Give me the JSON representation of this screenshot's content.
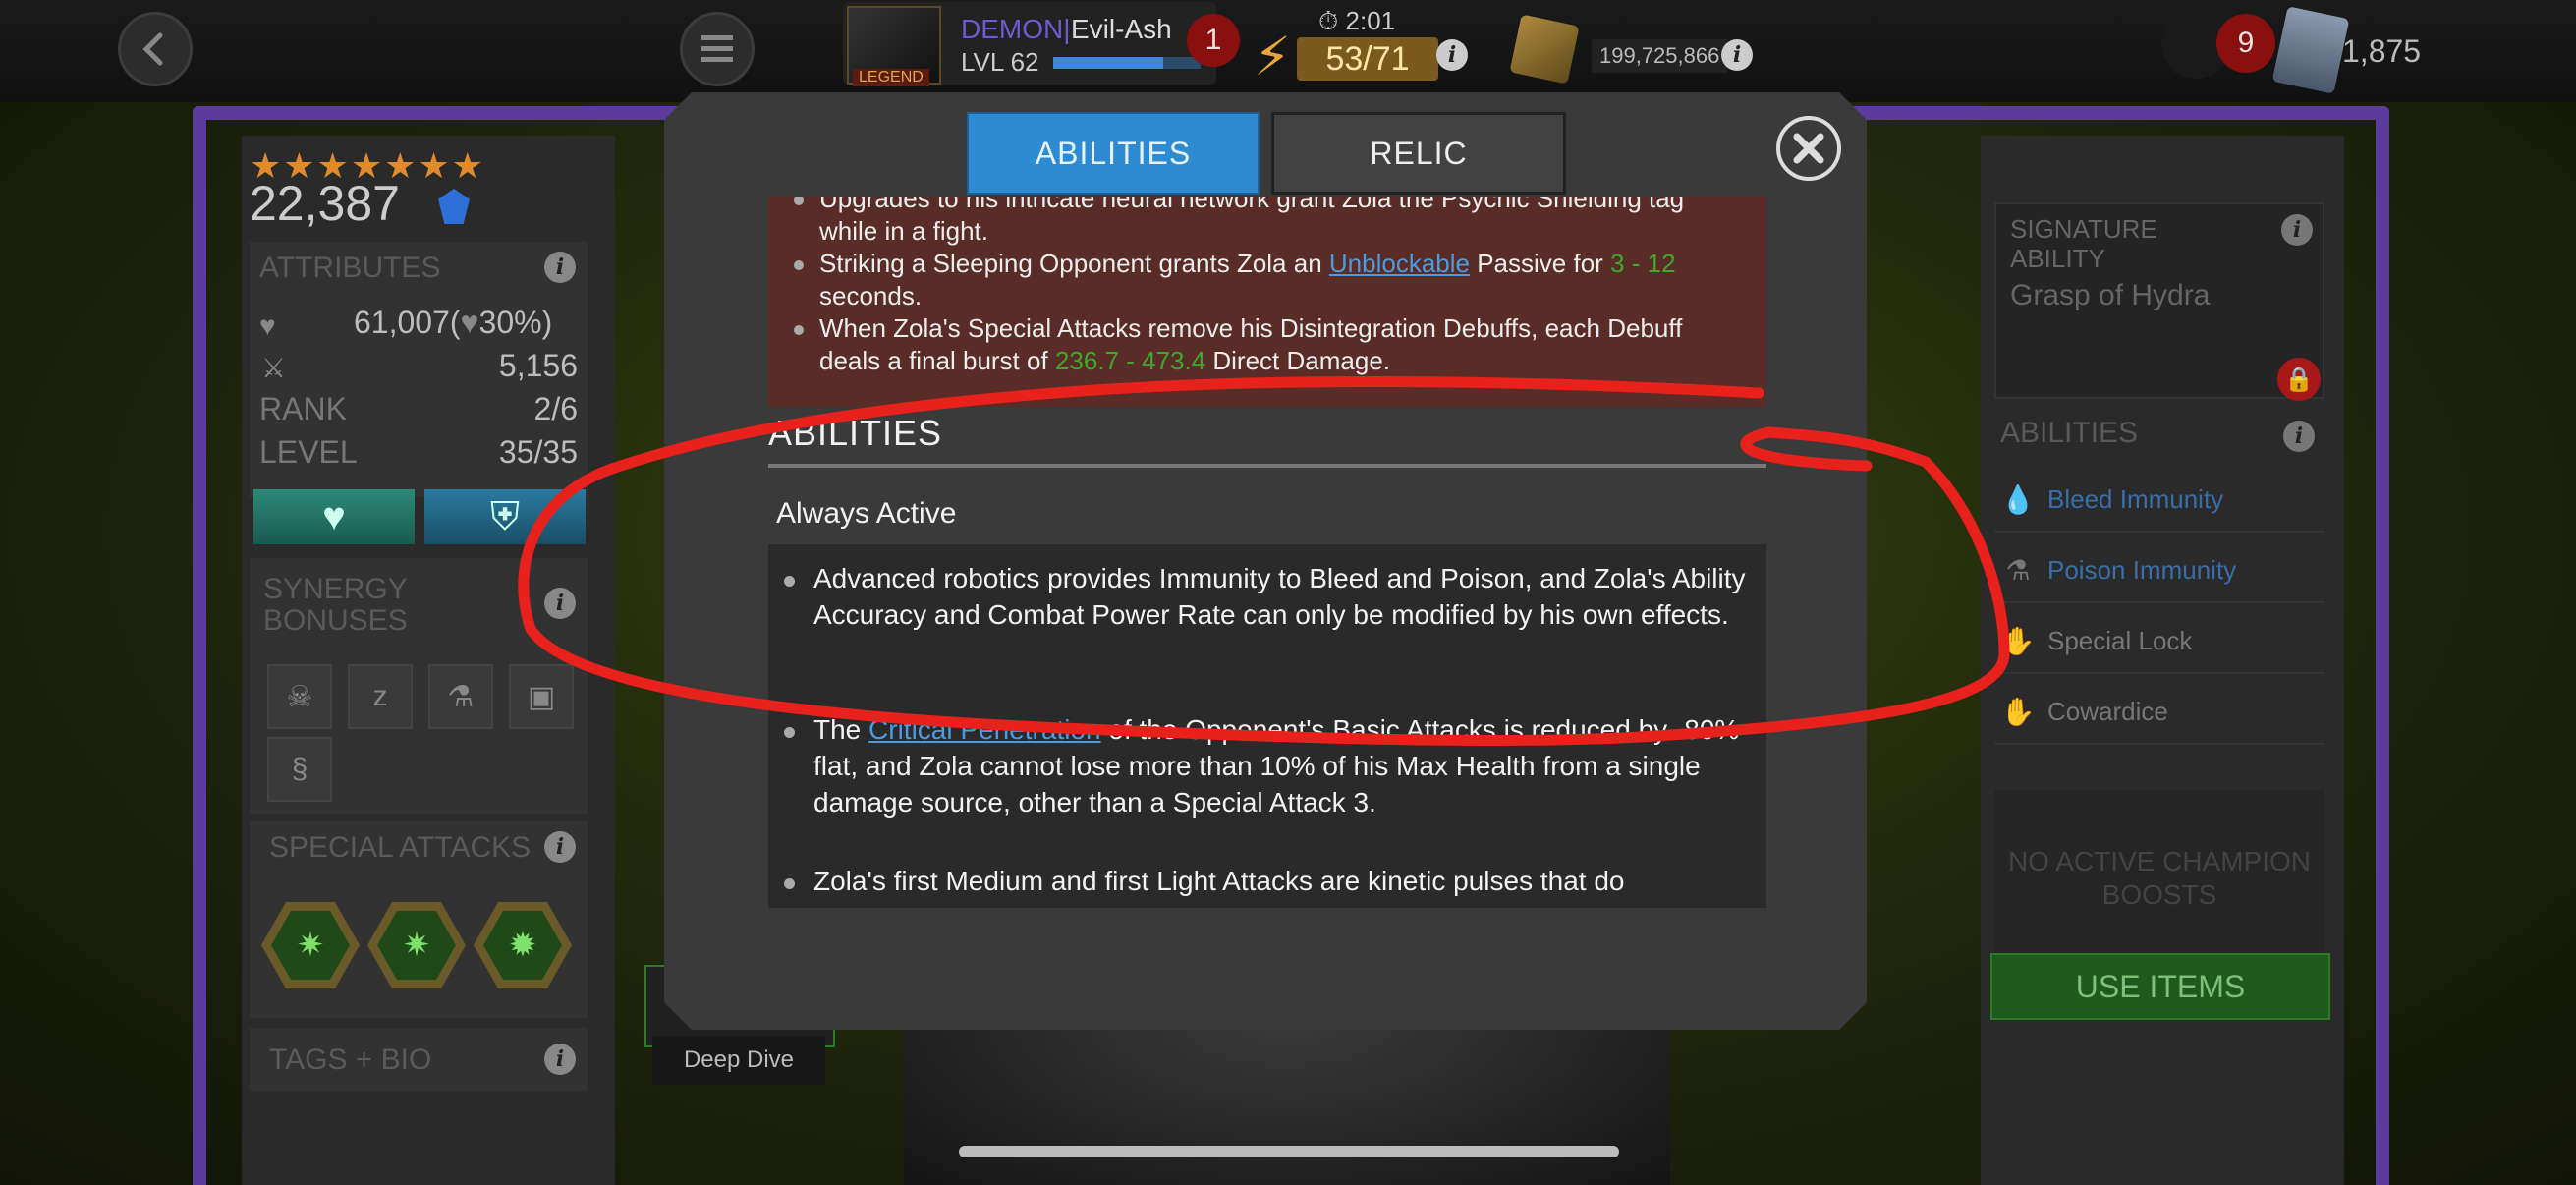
{
  "topbar": {
    "back_icon": "chevron-left-icon",
    "menu_icon": "hamburger-menu-icon",
    "player": {
      "clan_tag": "DEMON|",
      "name": "Evil-Ash",
      "level": "LVL 62",
      "legend_label": "LEGEND"
    },
    "notification_count": "1",
    "timer": "2:01",
    "energy": "53/71",
    "gold": "199,725,866",
    "alerts_count": "9",
    "units": "1,875"
  },
  "left_panel": {
    "stars": "★★★★★★★",
    "rating": "22,387",
    "attributes": {
      "title": "ATTRIBUTES",
      "health": "61,007",
      "health_bonus": "30%",
      "attack": "5,156",
      "rank_label": "RANK",
      "rank": "2/6",
      "level_label": "LEVEL",
      "level": "35/35"
    },
    "synergy_title": "SYNERGY BONUSES",
    "special_title": "SPECIAL ATTACKS",
    "tags_title": "TAGS + BIO"
  },
  "right_panel": {
    "signature_title": "SIGNATURE ABILITY",
    "signature_name": "Grasp of Hydra",
    "abilities_title": "ABILITIES",
    "abilities": [
      {
        "label": "Bleed Immunity",
        "icon": "blood-drop-icon",
        "color": "#3a6ea8"
      },
      {
        "label": "Poison Immunity",
        "icon": "poison-flask-icon",
        "color": "#3a6ea8"
      },
      {
        "label": "Special Lock",
        "icon": "hand-lock-icon",
        "color": "#777777"
      },
      {
        "label": "Cowardice",
        "icon": "hand-icon",
        "color": "#777777"
      }
    ],
    "no_boosts": "NO ACTIVE CHAMPION BOOSTS",
    "use_items": "USE ITEMS"
  },
  "background": {
    "deep_dive": "Deep Dive"
  },
  "modal": {
    "tab_abilities": "ABILITIES",
    "tab_relic": "RELIC",
    "relic_box": {
      "item1": "Upgrades to his intricate neural network grant Zola the Psychic Shielding tag while in a fight.",
      "item2_a": "Striking a Sleeping Opponent grants Zola an ",
      "item2_link": "Unblockable",
      "item2_b": " Passive for ",
      "item2_val": "3 - 12",
      "item2_c": " seconds.",
      "item3_a": "When Zola's Special Attacks remove his Disintegration Debuffs, each Debuff deals a final burst of ",
      "item3_val": "236.7 - 473.4",
      "item3_b": " Direct Damage."
    },
    "abilities_heading": "ABILITIES",
    "always_active": "Always Active",
    "ability1": "Advanced robotics provides Immunity to Bleed and Poison, and Zola's Ability Accuracy and Combat Power Rate can only be modified by his own effects.",
    "ability2_a": "The ",
    "ability2_link": "Critical Penetration",
    "ability2_b": " of the Opponent's Basic Attacks is reduced by -80% flat, and Zola cannot lose more than 10% of his Max Health from a single damage source, other than a Special Attack 3.",
    "ability3": "Zola's first Medium and first Light Attacks are kinetic pulses that do"
  },
  "colors": {
    "tab_active": "#2f8bd1",
    "accent_green": "#3ea92a",
    "link_blue": "#4a9be0",
    "annotation_red": "#e8211c",
    "frame_purple": "#5b3c9c"
  }
}
